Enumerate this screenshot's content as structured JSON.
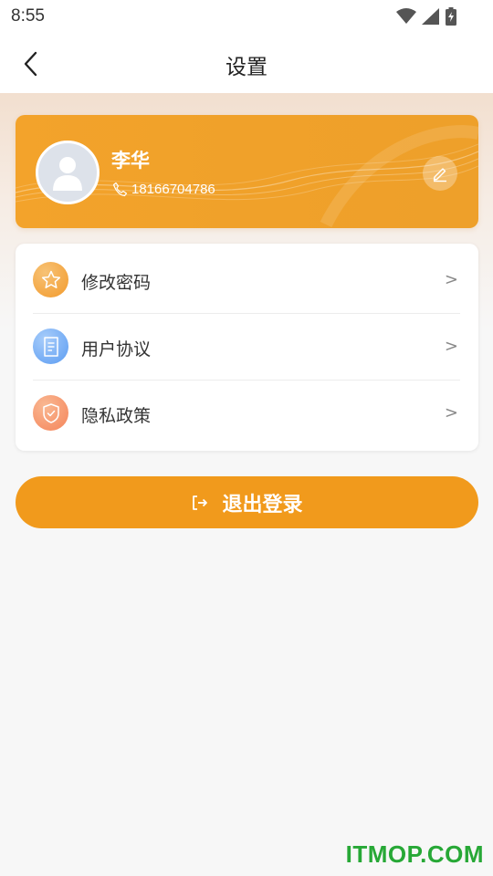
{
  "status_bar": {
    "time": "8:55",
    "icons": [
      "wifi-icon",
      "cellular-signal-icon",
      "battery-charging-icon"
    ]
  },
  "nav": {
    "back_icon": "chevron-left-icon",
    "title": "设置"
  },
  "profile": {
    "name": "李华",
    "phone": "18166704786",
    "avatar_icon": "default-avatar-icon",
    "phone_icon": "phone-icon",
    "edit_icon": "pencil-icon",
    "card_color": "#F19A1C"
  },
  "menu": {
    "items": [
      {
        "label": "修改密码",
        "icon": "star-icon",
        "arrow": ">",
        "icon_color": "#F19A1C"
      },
      {
        "label": "用户协议",
        "icon": "document-icon",
        "arrow": ">",
        "icon_color": "#5B9CF2"
      },
      {
        "label": "隐私政策",
        "icon": "shield-check-icon",
        "arrow": ">",
        "icon_color": "#F5845A"
      }
    ]
  },
  "logout": {
    "label": "退出登录",
    "icon": "logout-icon",
    "color": "#F19A1C"
  },
  "watermark": "ITMOP.COM"
}
